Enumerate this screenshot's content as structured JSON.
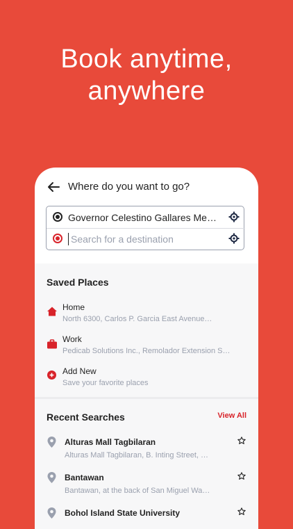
{
  "headline": {
    "line1": "Book anytime,",
    "line2": "anywhere"
  },
  "header": {
    "title": "Where do you want to go?"
  },
  "route": {
    "origin": "Governor Celestino Gallares Mem…",
    "destination_value": "",
    "destination_placeholder": "Search for a destination"
  },
  "saved_places": {
    "title": "Saved Places",
    "items": [
      {
        "name": "Home",
        "address": "North 6300, Carlos P. Garcia East Avenue…",
        "icon": "home-icon"
      },
      {
        "name": "Work",
        "address": "Pedicab Solutions Inc., Remolador Extension S…",
        "icon": "briefcase-icon"
      },
      {
        "name": "Add New",
        "address": "Save your favorite places",
        "icon": "add-circle-icon"
      }
    ]
  },
  "recent_searches": {
    "title": "Recent Searches",
    "view_all": "View All",
    "items": [
      {
        "name": "Alturas Mall Tagbilaran",
        "address": "Alturas Mall Tagbilaran, B. Inting Street, …",
        "icon": "location-pin-icon"
      },
      {
        "name": "Bantawan",
        "address": "Bantawan, at the back of San Miguel Wa…",
        "icon": "location-pin-icon"
      },
      {
        "name": "Bohol Island State University",
        "address": "",
        "icon": "location-pin-icon"
      }
    ]
  },
  "colors": {
    "brand": "#E84A3A",
    "accent": "#D8232A",
    "muted": "#9AA0AE"
  }
}
